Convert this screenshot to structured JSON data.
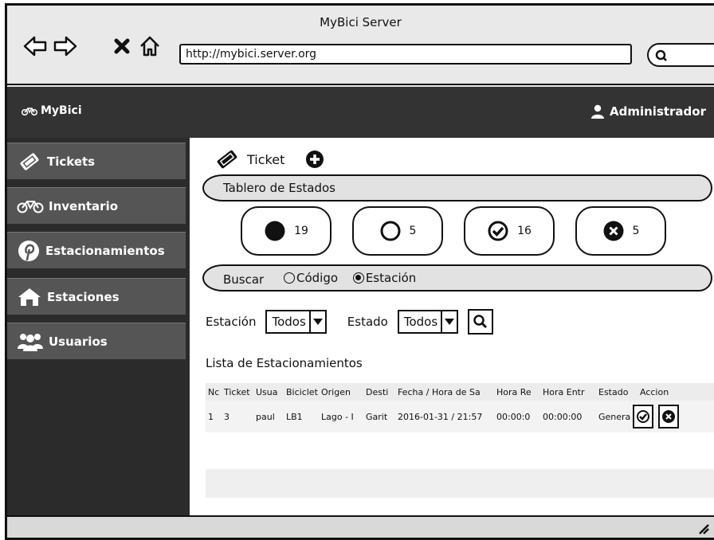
{
  "window": {
    "title": "MyBici Server"
  },
  "browser": {
    "url": "http://mybici.server.org",
    "nav_icons": [
      "back-arrow-icon",
      "forward-arrow-icon",
      "close-icon",
      "home-icon"
    ],
    "search_icon": "search-icon"
  },
  "appbar": {
    "brand": "MyBici",
    "user": "Administrador"
  },
  "sidebar": {
    "items": [
      {
        "label": "Tickets",
        "icon": "ticket-icon"
      },
      {
        "label": "Inventario",
        "icon": "bicycle-icon"
      },
      {
        "label": "Estacionamientos",
        "icon": "pinterest-icon"
      },
      {
        "label": "Estaciones",
        "icon": "home-icon"
      },
      {
        "label": "Usuarios",
        "icon": "users-icon"
      }
    ]
  },
  "main": {
    "ticket_label": "Ticket",
    "board_title": "Tablero de Estados",
    "states": [
      {
        "count": "19",
        "icon": "filled-circle-icon"
      },
      {
        "count": "5",
        "icon": "empty-circle-icon"
      },
      {
        "count": "16",
        "icon": "check-circle-icon"
      },
      {
        "count": "5",
        "icon": "x-circle-icon"
      }
    ],
    "search": {
      "label": "Buscar",
      "options": [
        {
          "label": "Código",
          "selected": false
        },
        {
          "label": "Estación",
          "selected": true
        }
      ]
    },
    "filters": {
      "station_label": "Estación",
      "station_value": "Todos",
      "state_label": "Estado",
      "state_value": "Todos"
    },
    "list_title": "Lista de Estacionamientos",
    "table": {
      "headers": [
        "Nc",
        "Ticket",
        "Usua",
        "Biciclet",
        "Origen",
        "Desti",
        "Fecha / Hora de Sa",
        "Hora Re",
        "Hora Entr",
        "Estado",
        "Accion"
      ],
      "rows": [
        [
          "1",
          "3",
          "paul",
          "LB1",
          "Lago - I",
          "Garit",
          "2016-01-31 / 21:57",
          "00:00:0",
          "00:00:00",
          "Genera",
          ""
        ]
      ]
    }
  }
}
